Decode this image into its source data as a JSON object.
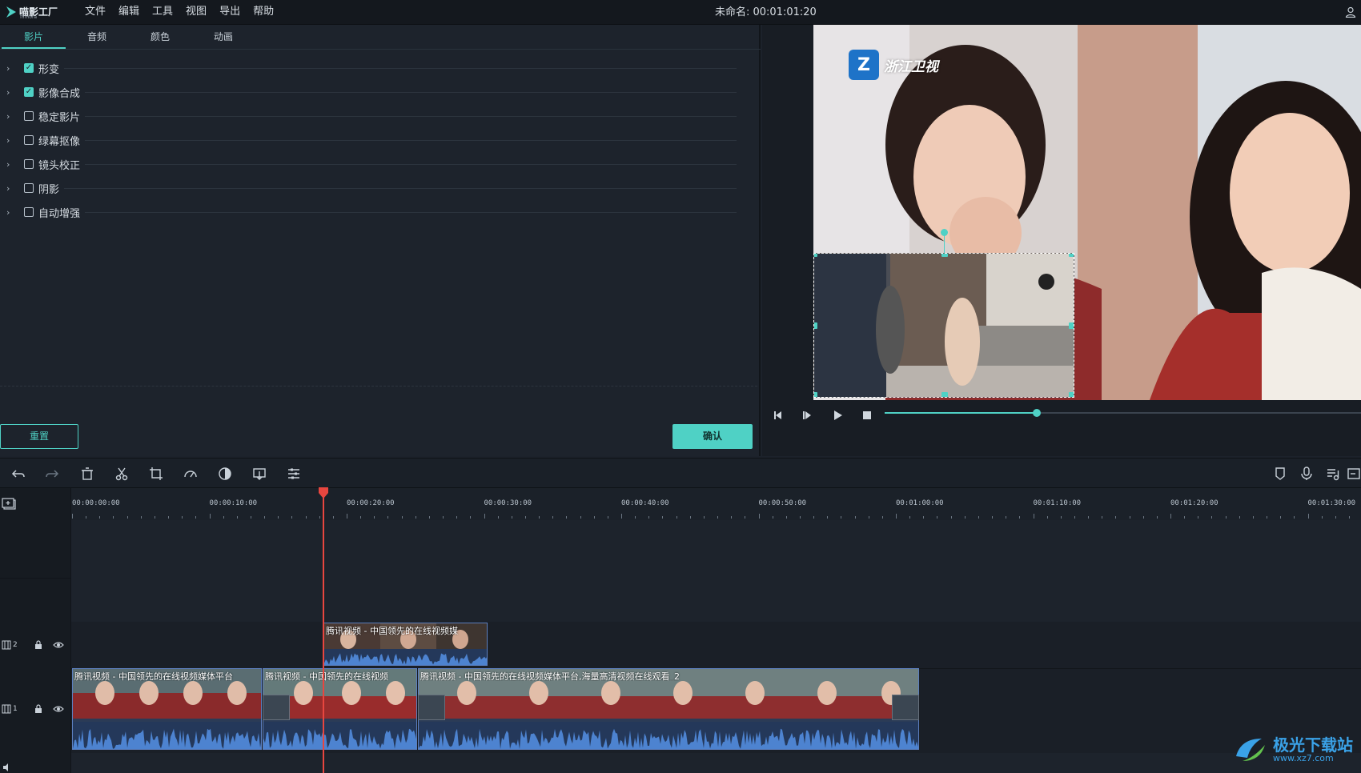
{
  "app": {
    "logo_text": "喵影工厂",
    "logo_sub": "filmora",
    "menu": [
      "文件",
      "编辑",
      "工具",
      "视图",
      "导出",
      "帮助"
    ],
    "title": "未命名: 00:01:01:20"
  },
  "panel": {
    "tabs": [
      "影片",
      "音频",
      "颜色",
      "动画"
    ],
    "active_tab": 0,
    "options": [
      {
        "label": "形变",
        "checked": true
      },
      {
        "label": "影像合成",
        "checked": true
      },
      {
        "label": "稳定影片",
        "checked": false
      },
      {
        "label": "绿幕抠像",
        "checked": false
      },
      {
        "label": "镜头校正",
        "checked": false
      },
      {
        "label": "阴影",
        "checked": false
      },
      {
        "label": "自动增强",
        "checked": false
      }
    ],
    "reset_label": "重置",
    "ok_label": "确认"
  },
  "preview": {
    "channel_name": "浙江卫视",
    "progress": 0.32
  },
  "timeline": {
    "ticks": [
      "00:00:00:00",
      "00:00:10:00",
      "00:00:20:00",
      "00:00:30:00",
      "00:00:40:00",
      "00:00:50:00",
      "00:01:00:00",
      "00:01:10:00",
      "00:01:20:00",
      "00:01:30:00"
    ],
    "track2_label": "2",
    "track1_label": "1",
    "clips": {
      "track2": "腾讯视频 - 中国领先的在线视频媒",
      "track1_a": "腾讯视频 - 中国领先的在线视频媒体平台",
      "track1_b": "腾讯视频 - 中国领先的在线视频",
      "track1_c": "腾讯视频 - 中国领先的在线视频媒体平台,海量高清视频在线观看_2"
    }
  },
  "watermark": {
    "line1": "极光下载站",
    "line2": "www.xz7.com"
  },
  "colors": {
    "accent": "#4fd1c5",
    "playhead": "#e8463f",
    "clip": "#2b3b56"
  }
}
